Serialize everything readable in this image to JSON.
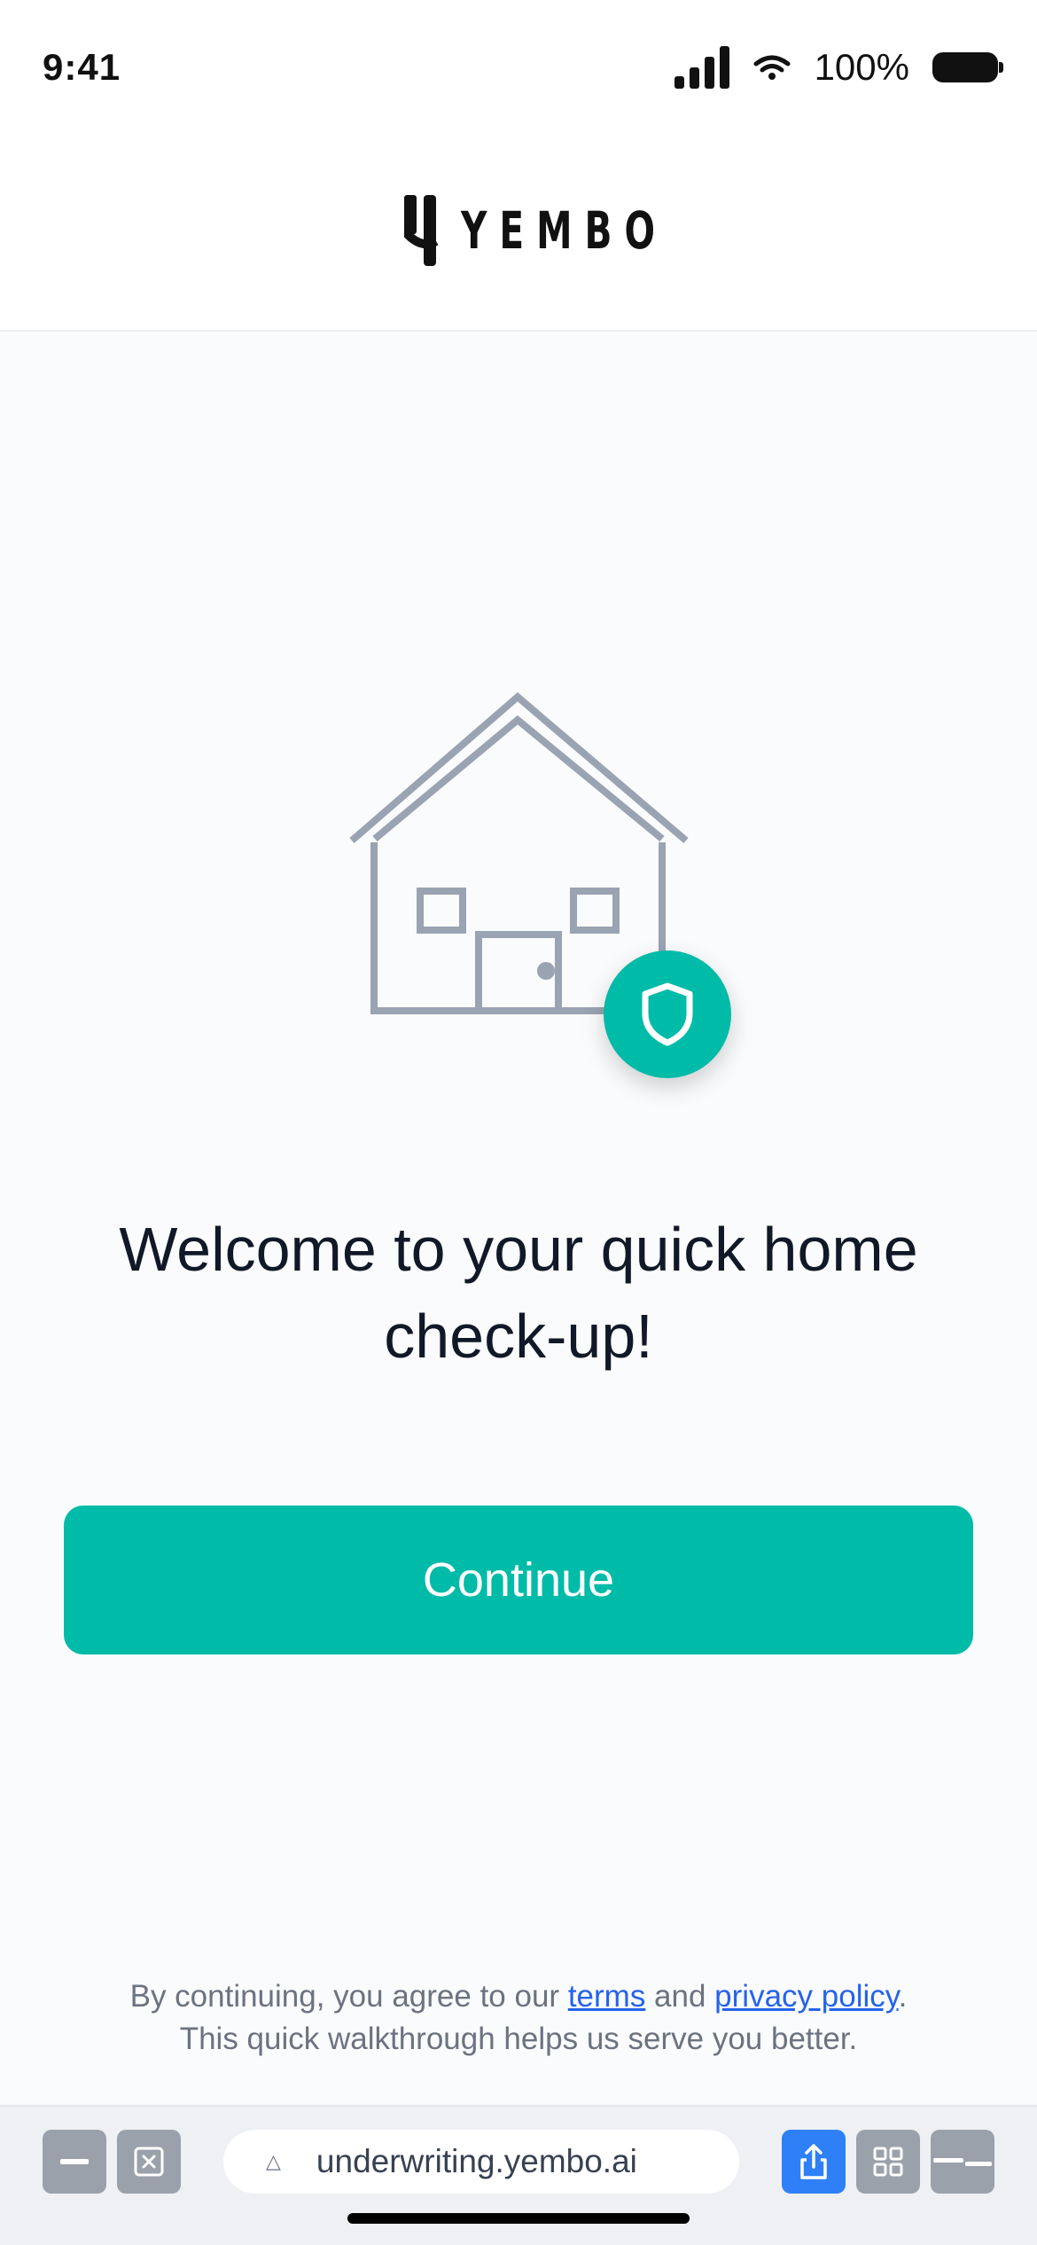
{
  "status_bar": {
    "time": "9:41",
    "battery_percent": "100%",
    "icons": [
      "cellular-signal-icon",
      "wifi-icon",
      "battery-icon"
    ]
  },
  "header": {
    "logo_text": "YEMBO"
  },
  "main": {
    "illustration": [
      "house-icon",
      "shield-icon"
    ],
    "headline": "Welcome to your quick home check-up!",
    "continue_label": "Continue"
  },
  "legal": {
    "prefix": "By continuing, you agree to our ",
    "terms_link": "terms",
    "middle": " and ",
    "privacy_link": "privacy policy",
    "suffix": ".",
    "line2": "This quick walkthrough helps us serve you better."
  },
  "browser_toolbar": {
    "url": "underwriting.yembo.ai",
    "icons": [
      "minimize-icon",
      "close-tab-icon",
      "lock-icon",
      "share-icon",
      "tabs-grid-icon",
      "sidebar-icon"
    ]
  },
  "colors": {
    "accent": "#00bba7",
    "link": "#2563eb",
    "illustration_stroke": "#9aa3b2",
    "text_primary": "#111827",
    "text_secondary": "#6b7280"
  }
}
